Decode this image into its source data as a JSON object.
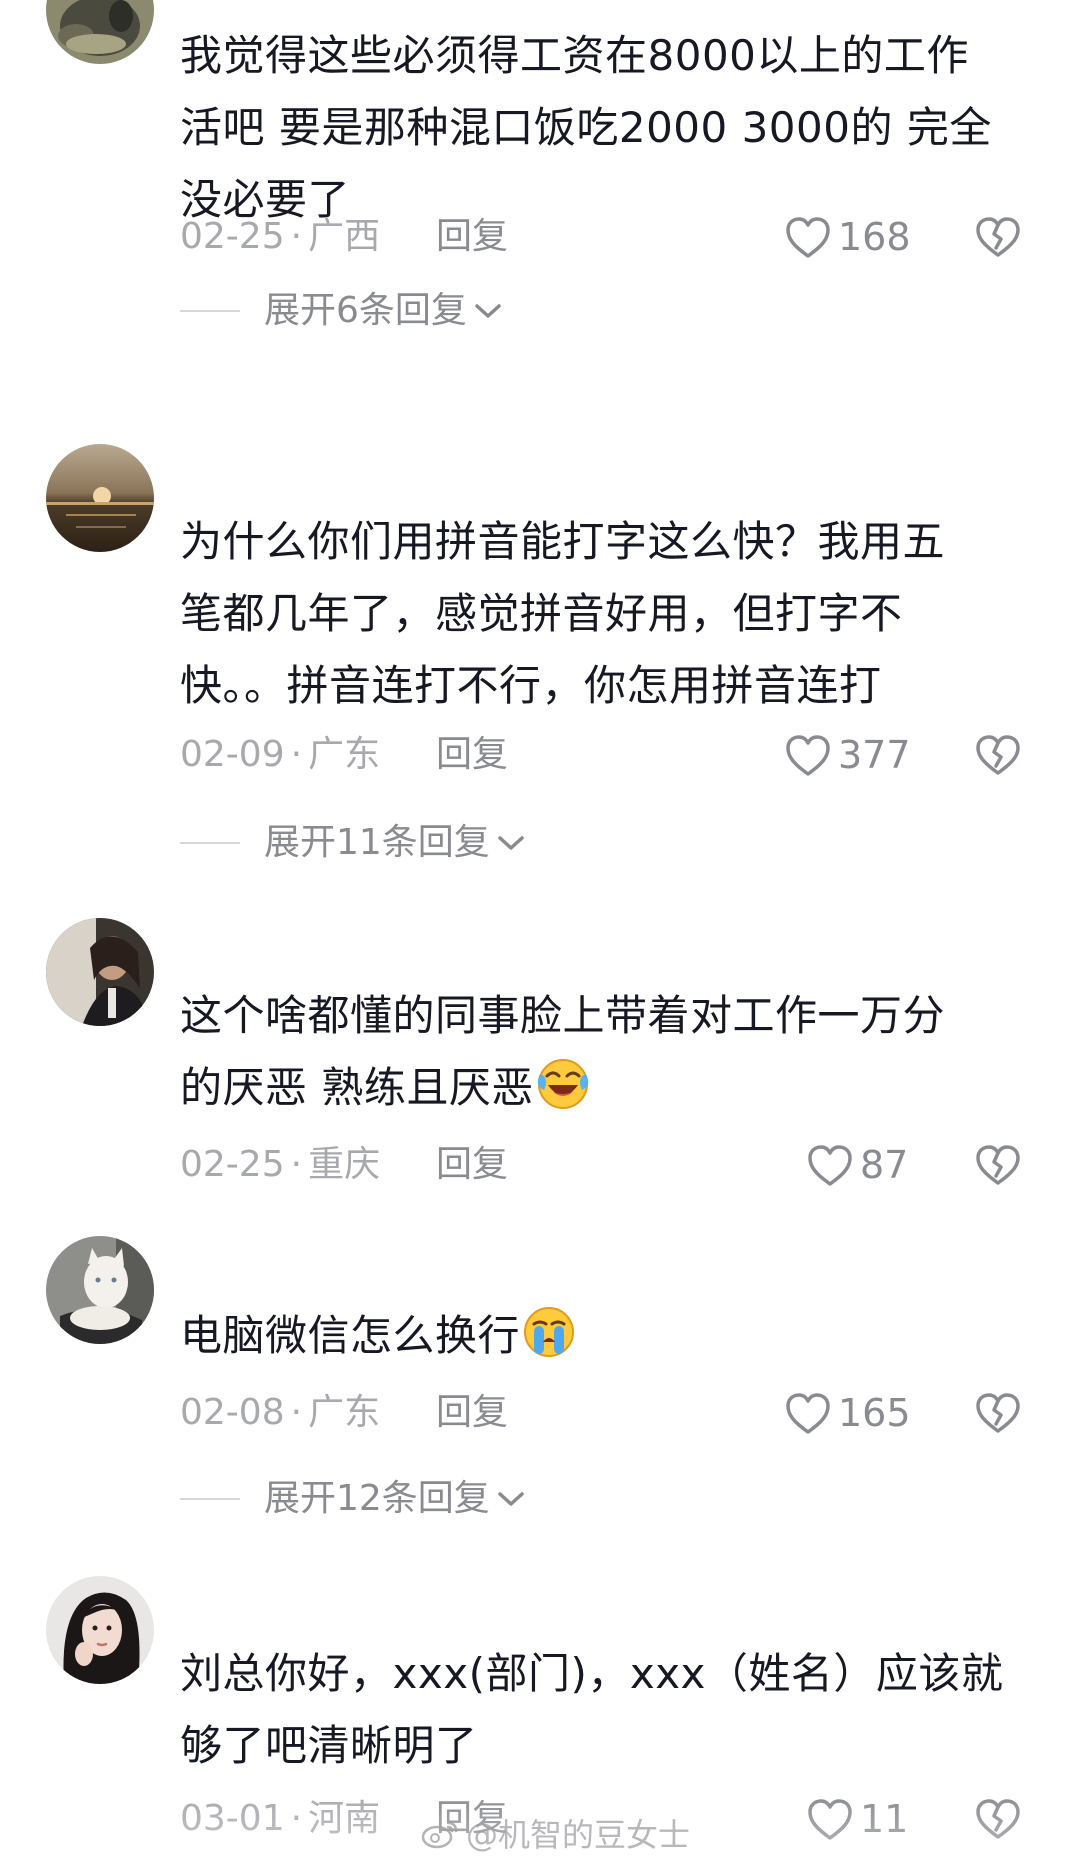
{
  "comments": [
    {
      "text": "我觉得这些必须得工资在8000以上的工作活吧 要是那种混口饭吃2000 3000的 完全没必要了",
      "lines": [
        "我觉得这些必须得工资在8000以上的工作",
        "活吧 要是那种混口饭吃2000 3000的 完全",
        "没必要了"
      ],
      "date": "02-25",
      "location": "广西",
      "reply_label": "回复",
      "likes": "168",
      "expand_label": "展开6条回复"
    },
    {
      "text": "为什么你们用拼音能打字这么快？我用五笔都几年了，感觉拼音好用，但打字不快。。拼音连打不行，你怎用拼音连打",
      "lines": [
        "为什么你们用拼音能打字这么快？我用五",
        "笔都几年了，感觉拼音好用，但打字不",
        "快。。拼音连打不行，你怎用拼音连打"
      ],
      "date": "02-09",
      "location": "广东",
      "reply_label": "回复",
      "likes": "377",
      "expand_label": "展开11条回复"
    },
    {
      "text": "这个啥都懂的同事脸上带着对工作一万分的厌恶 熟练且厌恶",
      "lines": [
        "这个啥都懂的同事脸上带着对工作一万分",
        "的厌恶 熟练且厌恶"
      ],
      "emoji": "laughing-crying-emoji",
      "date": "02-25",
      "location": "重庆",
      "reply_label": "回复",
      "likes": "87"
    },
    {
      "text": "电脑微信怎么换行",
      "lines": [
        "电脑微信怎么换行"
      ],
      "emoji": "crying-emoji",
      "date": "02-08",
      "location": "广东",
      "reply_label": "回复",
      "likes": "165",
      "expand_label": "展开12条回复"
    },
    {
      "text": "刘总你好，xxx(部门)，xxx（姓名）应该就够了吧清晰明了",
      "lines": [
        "刘总你好，xxx(部门)，xxx（姓名）应该就",
        "够了吧清晰明了"
      ],
      "date": "03-01",
      "location": "河南",
      "reply_label": "回复",
      "likes": "11"
    }
  ],
  "watermark": "@机智的豆女士",
  "meta_separator": "·",
  "icons": {
    "like": "heart-outline-icon",
    "dislike": "broken-heart-icon",
    "expand": "chevron-down-icon",
    "watermark": "weibo-logo-icon"
  },
  "colors": {
    "text": "#161823",
    "meta": "#a8a9ad",
    "action": "#8a8b91",
    "divider": "#d6d7d9"
  }
}
